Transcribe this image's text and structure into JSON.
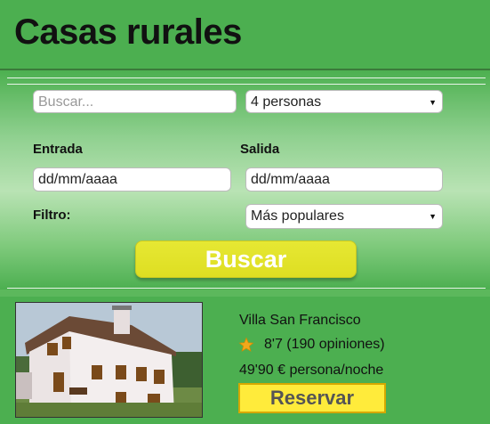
{
  "header": {
    "title": "Casas rurales"
  },
  "search": {
    "placeholder": "Buscar...",
    "guests_selected": "4 personas",
    "checkin_label": "Entrada",
    "checkin_value": "dd/mm/aaaa",
    "checkout_label": "Salida",
    "checkout_value": "dd/mm/aaaa",
    "filter_label": "Filtro:",
    "filter_selected": "Más populares",
    "submit_label": "Buscar"
  },
  "listing": {
    "name": "Villa San Francisco",
    "rating": "8'7 (190 opiniones)",
    "price": "49'90 € persona/noche",
    "reserve_label": "Reservar",
    "rating_icon": "star-icon",
    "photo": "house-photo"
  },
  "colors": {
    "header_bg": "#4caf50",
    "button_search": "#e2e42a",
    "button_reserve": "#ffeb3b"
  }
}
